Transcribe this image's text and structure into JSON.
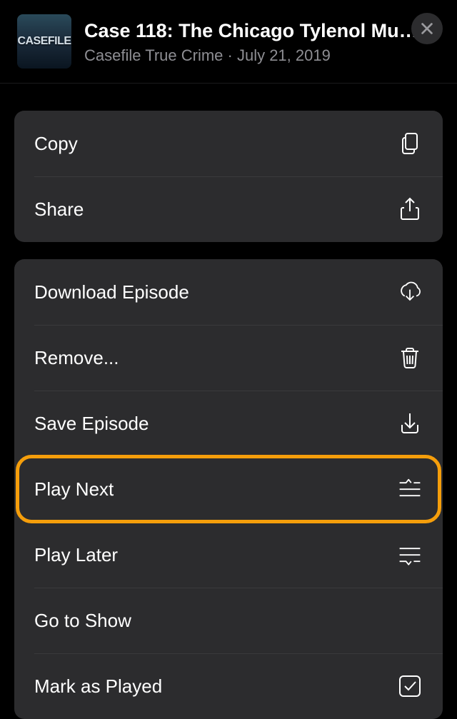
{
  "header": {
    "artwork_text": "CASEFILE",
    "title": "Case 118: The Chicago Tylenol Mur...",
    "podcast": "Casefile True Crime",
    "separator": " · ",
    "date": "July 21, 2019"
  },
  "group1": [
    {
      "label": "Copy",
      "icon": "copy-doc-icon",
      "name": "copy-button"
    },
    {
      "label": "Share",
      "icon": "share-icon",
      "name": "share-button"
    }
  ],
  "group2": [
    {
      "label": "Download Episode",
      "icon": "download-cloud-icon",
      "name": "download-button"
    },
    {
      "label": "Remove...",
      "icon": "trash-icon",
      "name": "remove-button"
    },
    {
      "label": "Save Episode",
      "icon": "save-icon",
      "name": "save-button"
    },
    {
      "label": "Play Next",
      "icon": "play-next-icon",
      "name": "play-next-button",
      "highlighted": true
    },
    {
      "label": "Play Later",
      "icon": "play-later-icon",
      "name": "play-later-button"
    },
    {
      "label": "Go to Show",
      "icon": "",
      "name": "go-to-show-button"
    },
    {
      "label": "Mark as Played",
      "icon": "checkbox-icon",
      "name": "mark-played-button"
    }
  ]
}
